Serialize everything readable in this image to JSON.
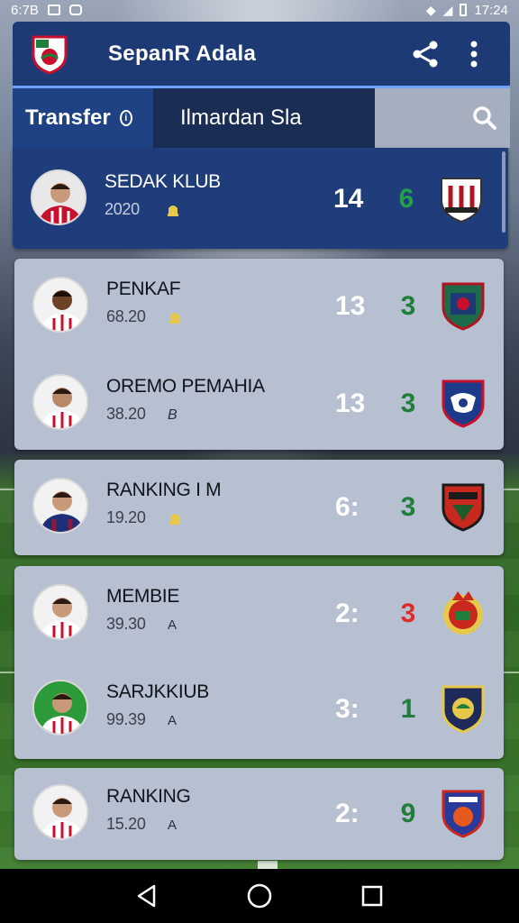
{
  "status": {
    "left_text": "6:7B",
    "time": "17:24"
  },
  "header": {
    "title": "SepanR Adala",
    "logo_icon": "club-shield-icon",
    "share_icon": "share-icon",
    "menu_icon": "more-vertical-icon"
  },
  "tabs": {
    "active": "Transfer",
    "second": "Ilmardan Sla",
    "search_icon": "search-icon"
  },
  "rows": [
    {
      "name": "SEDAK KLUB",
      "sub": "2020",
      "badge": "bell-icon",
      "score": "14",
      "stat": "6",
      "stat_color": "#22a04a",
      "crest": "crest-1"
    },
    {
      "name": "PENKAF",
      "sub": "68.20",
      "badge": "bell-icon",
      "score": "13",
      "stat": "3",
      "stat_color": "#1e7e3a",
      "crest": "crest-2"
    },
    {
      "name": "OREMO PEMAHIA",
      "sub": "38.20",
      "badge": "B",
      "score": "13",
      "stat": "3",
      "stat_color": "#1e7e3a",
      "crest": "crest-3"
    },
    {
      "name": "RANKING I M",
      "sub": "19.20",
      "badge": "bell-icon",
      "score": "6:",
      "stat": "3",
      "stat_color": "#1e7e3a",
      "crest": "crest-4"
    },
    {
      "name": "MEMBIE",
      "sub": "39.30",
      "badge": "A",
      "score": "2:",
      "stat": "3",
      "stat_color": "#e02b2b",
      "crest": "crest-5"
    },
    {
      "name": "SARJKKIUB",
      "sub": "99.39",
      "badge": "A",
      "score": "3:",
      "stat": "1",
      "stat_color": "#1e7e3a",
      "crest": "crest-6"
    },
    {
      "name": "RANKING",
      "sub": "15.20",
      "badge": "A",
      "score": "2:",
      "stat": "9",
      "stat_color": "#1e7e3a",
      "crest": "crest-7"
    }
  ],
  "nav": {
    "back": "back-icon",
    "home": "home-icon",
    "recents": "recents-icon"
  }
}
